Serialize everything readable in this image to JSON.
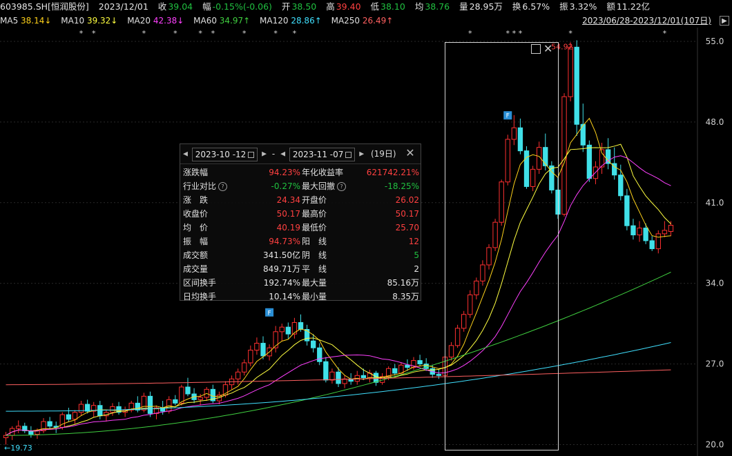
{
  "header": {
    "code": "603985.SH[恒润股份]",
    "date": "2023/12/01",
    "close_label": "收",
    "close": "39.04",
    "change_label": "幅",
    "change": "-0.15%(-0.06)",
    "open_label": "开",
    "open": "38.50",
    "high_label": "高",
    "high": "39.40",
    "low_label": "低",
    "low": "38.10",
    "avg_label": "均",
    "avg": "38.76",
    "vol_label": "量",
    "vol": "28.95万",
    "turnover_label": "换",
    "turnover": "6.57%",
    "amp_label": "振",
    "amp": "3.32%",
    "amount_label": "额",
    "amount": "11.22亿"
  },
  "ma_bar": [
    {
      "name": "MA5",
      "value": "38.14↓",
      "color": "#ffd21a"
    },
    {
      "name": "MA10",
      "value": "39.32↓",
      "color": "#ffff40"
    },
    {
      "name": "MA20",
      "value": "42.38↓",
      "color": "#ff40ff"
    },
    {
      "name": "MA60",
      "value": "34.97↑",
      "color": "#40d040"
    },
    {
      "name": "MA120",
      "value": "28.86↑",
      "color": "#40e0ff"
    },
    {
      "name": "MA250",
      "value": "26.49↑",
      "color": "#ff6060"
    }
  ],
  "range_label": "2023/06/28-2023/12/01(107日)",
  "scroll_btn": "▶",
  "panel": {
    "start_date": "2023-10 -12",
    "separator": "-",
    "end_date": "2023-11 -07",
    "days": "(19日)",
    "rows": [
      [
        {
          "k": "涨跌幅",
          "v": "94.23%",
          "c": "up"
        },
        {
          "k": "年化收益率",
          "v": "621742.21%",
          "c": "up"
        }
      ],
      [
        {
          "k": "行业对比",
          "v": "-0.27%",
          "c": "down",
          "q": true
        },
        {
          "k": "最大回撤",
          "v": "-18.25%",
          "c": "down",
          "q": true
        }
      ],
      [
        {
          "k": "涨　跌",
          "v": "24.34",
          "c": "up"
        },
        {
          "k": "开盘价",
          "v": "26.02",
          "c": "up"
        }
      ],
      [
        {
          "k": "收盘价",
          "v": "50.17",
          "c": "up"
        },
        {
          "k": "最高价",
          "v": "50.17",
          "c": "up"
        }
      ],
      [
        {
          "k": "均　价",
          "v": "40.19",
          "c": "up"
        },
        {
          "k": "最低价",
          "v": "25.70",
          "c": "up"
        }
      ],
      [
        {
          "k": "振　幅",
          "v": "94.73%",
          "c": "up"
        },
        {
          "k": "阳　线",
          "v": "12",
          "c": "up"
        }
      ],
      [
        {
          "k": "成交额",
          "v": "341.50亿",
          "c": "wh"
        },
        {
          "k": "阴　线",
          "v": "5",
          "c": "down"
        }
      ],
      [
        {
          "k": "成交量",
          "v": "849.71万",
          "c": "wh"
        },
        {
          "k": "平　线",
          "v": "2",
          "c": "wh"
        }
      ],
      [
        {
          "k": "区间换手",
          "v": "192.74%",
          "c": "wh"
        },
        {
          "k": "最大量",
          "v": "85.16万",
          "c": "wh"
        }
      ],
      [
        {
          "k": "日均换手",
          "v": "10.14%",
          "c": "wh"
        },
        {
          "k": "最小量",
          "v": "8.35万",
          "c": "wh"
        }
      ]
    ]
  },
  "chart_data": {
    "type": "candlestick",
    "x_range": [
      0,
      107
    ],
    "ylim": [
      19.0,
      55.5
    ],
    "y_ticks": [
      20.0,
      27.0,
      34.0,
      41.0,
      48.0,
      55.0
    ],
    "high_marker": "54.92",
    "low_marker": "19.73",
    "up_color": "#ff3030",
    "down_color": "#40e0e8",
    "selection_range": [
      70,
      89
    ],
    "star_indices": [
      12,
      14,
      22,
      27,
      31,
      33,
      38,
      43,
      46,
      74,
      80,
      81,
      82,
      90,
      105
    ],
    "f_markers": [
      {
        "i": 42,
        "price": 31.0
      },
      {
        "i": 80,
        "price": 48.1
      }
    ],
    "candles": [
      [
        20.6,
        21.1,
        20.0,
        20.8
      ],
      [
        20.8,
        21.6,
        20.4,
        21.4
      ],
      [
        21.4,
        22.1,
        21.0,
        21.6
      ],
      [
        21.6,
        21.9,
        21.0,
        21.2
      ],
      [
        21.2,
        21.6,
        20.6,
        20.9
      ],
      [
        20.9,
        21.4,
        20.5,
        21.2
      ],
      [
        21.2,
        22.3,
        21.0,
        22.0
      ],
      [
        22.0,
        22.4,
        21.4,
        21.6
      ],
      [
        21.6,
        22.0,
        21.0,
        21.5
      ],
      [
        21.5,
        22.8,
        21.3,
        22.6
      ],
      [
        22.6,
        23.2,
        22.0,
        22.2
      ],
      [
        22.2,
        23.0,
        21.8,
        22.8
      ],
      [
        22.8,
        23.8,
        22.5,
        23.5
      ],
      [
        23.5,
        23.9,
        22.7,
        22.9
      ],
      [
        22.9,
        23.7,
        22.4,
        23.4
      ],
      [
        23.4,
        23.8,
        22.2,
        22.5
      ],
      [
        22.5,
        23.0,
        22.0,
        22.8
      ],
      [
        22.8,
        23.6,
        22.5,
        23.3
      ],
      [
        23.3,
        23.7,
        22.6,
        22.8
      ],
      [
        22.8,
        23.3,
        22.4,
        23.0
      ],
      [
        23.0,
        23.8,
        22.8,
        23.6
      ],
      [
        23.6,
        24.2,
        22.8,
        23.0
      ],
      [
        23.0,
        24.5,
        22.8,
        24.2
      ],
      [
        24.2,
        24.6,
        22.4,
        22.7
      ],
      [
        22.7,
        23.4,
        22.2,
        23.2
      ],
      [
        23.2,
        23.8,
        22.6,
        22.9
      ],
      [
        22.9,
        24.2,
        22.7,
        23.9
      ],
      [
        23.9,
        24.3,
        23.4,
        23.6
      ],
      [
        23.6,
        25.2,
        23.4,
        25.0
      ],
      [
        25.0,
        25.8,
        24.2,
        24.4
      ],
      [
        24.4,
        24.9,
        23.6,
        23.9
      ],
      [
        23.9,
        24.4,
        23.4,
        24.1
      ],
      [
        24.1,
        25.0,
        23.8,
        24.8
      ],
      [
        24.8,
        25.2,
        23.6,
        23.8
      ],
      [
        23.8,
        24.6,
        23.5,
        24.3
      ],
      [
        24.3,
        25.5,
        24.1,
        25.2
      ],
      [
        25.2,
        26.0,
        24.8,
        25.7
      ],
      [
        25.7,
        26.6,
        25.2,
        26.3
      ],
      [
        26.3,
        27.4,
        26.0,
        27.1
      ],
      [
        27.1,
        28.6,
        26.8,
        28.2
      ],
      [
        28.2,
        29.3,
        27.8,
        28.8
      ],
      [
        28.8,
        29.4,
        27.4,
        27.7
      ],
      [
        27.7,
        28.7,
        27.3,
        28.4
      ],
      [
        28.4,
        30.3,
        28.0,
        29.8
      ],
      [
        29.8,
        30.5,
        29.0,
        30.2
      ],
      [
        30.2,
        30.6,
        29.2,
        29.6
      ],
      [
        29.6,
        31.0,
        29.2,
        30.6
      ],
      [
        30.6,
        31.3,
        29.8,
        30.0
      ],
      [
        30.0,
        30.4,
        28.6,
        29.0
      ],
      [
        29.0,
        29.6,
        28.0,
        28.4
      ],
      [
        28.4,
        28.8,
        26.9,
        27.2
      ],
      [
        27.2,
        27.6,
        25.4,
        25.6
      ],
      [
        25.6,
        26.6,
        25.3,
        26.3
      ],
      [
        26.3,
        26.7,
        25.0,
        25.3
      ],
      [
        25.3,
        26.0,
        24.9,
        25.7
      ],
      [
        25.7,
        26.2,
        25.2,
        25.5
      ],
      [
        25.5,
        26.4,
        25.2,
        26.0
      ],
      [
        26.0,
        26.6,
        25.6,
        25.8
      ],
      [
        25.8,
        26.5,
        25.4,
        26.2
      ],
      [
        26.2,
        26.4,
        25.1,
        25.4
      ],
      [
        25.4,
        26.2,
        25.2,
        25.9
      ],
      [
        25.9,
        26.8,
        25.6,
        26.6
      ],
      [
        26.6,
        27.0,
        26.0,
        26.2
      ],
      [
        26.2,
        27.1,
        26.0,
        26.9
      ],
      [
        26.9,
        27.4,
        26.4,
        26.7
      ],
      [
        26.7,
        27.6,
        26.5,
        27.3
      ],
      [
        27.3,
        27.8,
        26.8,
        27.0
      ],
      [
        27.0,
        27.5,
        26.4,
        26.6
      ],
      [
        26.6,
        26.9,
        25.8,
        26.1
      ],
      [
        26.1,
        26.5,
        25.7,
        26.0
      ],
      [
        26.0,
        27.8,
        25.7,
        27.6
      ],
      [
        27.6,
        28.9,
        27.3,
        28.6
      ],
      [
        28.6,
        30.4,
        28.4,
        30.1
      ],
      [
        30.1,
        31.6,
        29.8,
        31.3
      ],
      [
        31.3,
        33.4,
        31.0,
        33.0
      ],
      [
        33.0,
        34.5,
        32.6,
        34.2
      ],
      [
        34.2,
        36.0,
        33.8,
        35.6
      ],
      [
        35.6,
        37.4,
        35.2,
        37.1
      ],
      [
        37.1,
        39.6,
        36.8,
        39.3
      ],
      [
        39.3,
        43.0,
        39.0,
        42.8
      ],
      [
        42.8,
        46.9,
        42.5,
        46.5
      ],
      [
        46.5,
        48.6,
        46.0,
        47.5
      ],
      [
        47.5,
        48.3,
        45.2,
        45.5
      ],
      [
        45.5,
        45.9,
        42.2,
        42.4
      ],
      [
        42.4,
        44.2,
        42.0,
        43.9
      ],
      [
        43.9,
        46.3,
        43.5,
        45.8
      ],
      [
        45.8,
        47.0,
        43.8,
        44.2
      ],
      [
        44.2,
        44.6,
        41.8,
        42.1
      ],
      [
        42.1,
        43.2,
        39.6,
        40.0
      ],
      [
        40.0,
        50.5,
        39.8,
        50.2
      ],
      [
        50.2,
        54.92,
        49.8,
        54.5
      ],
      [
        54.5,
        55.1,
        46.8,
        47.8
      ],
      [
        47.8,
        49.6,
        45.4,
        46.0
      ],
      [
        46.0,
        46.4,
        42.8,
        43.1
      ],
      [
        43.1,
        44.6,
        42.6,
        44.1
      ],
      [
        44.1,
        46.2,
        43.5,
        45.6
      ],
      [
        45.6,
        46.6,
        43.9,
        44.4
      ],
      [
        44.4,
        45.8,
        43.0,
        43.4
      ],
      [
        43.4,
        44.3,
        41.2,
        41.6
      ],
      [
        41.6,
        42.2,
        38.6,
        39.0
      ],
      [
        39.0,
        39.6,
        37.8,
        38.2
      ],
      [
        38.2,
        39.4,
        37.6,
        38.8
      ],
      [
        38.8,
        39.2,
        37.4,
        37.7
      ],
      [
        37.7,
        38.1,
        36.8,
        37.0
      ],
      [
        37.0,
        38.6,
        36.6,
        38.3
      ],
      [
        38.3,
        39.4,
        38.0,
        38.6
      ],
      [
        38.5,
        39.4,
        38.1,
        39.04
      ]
    ]
  }
}
